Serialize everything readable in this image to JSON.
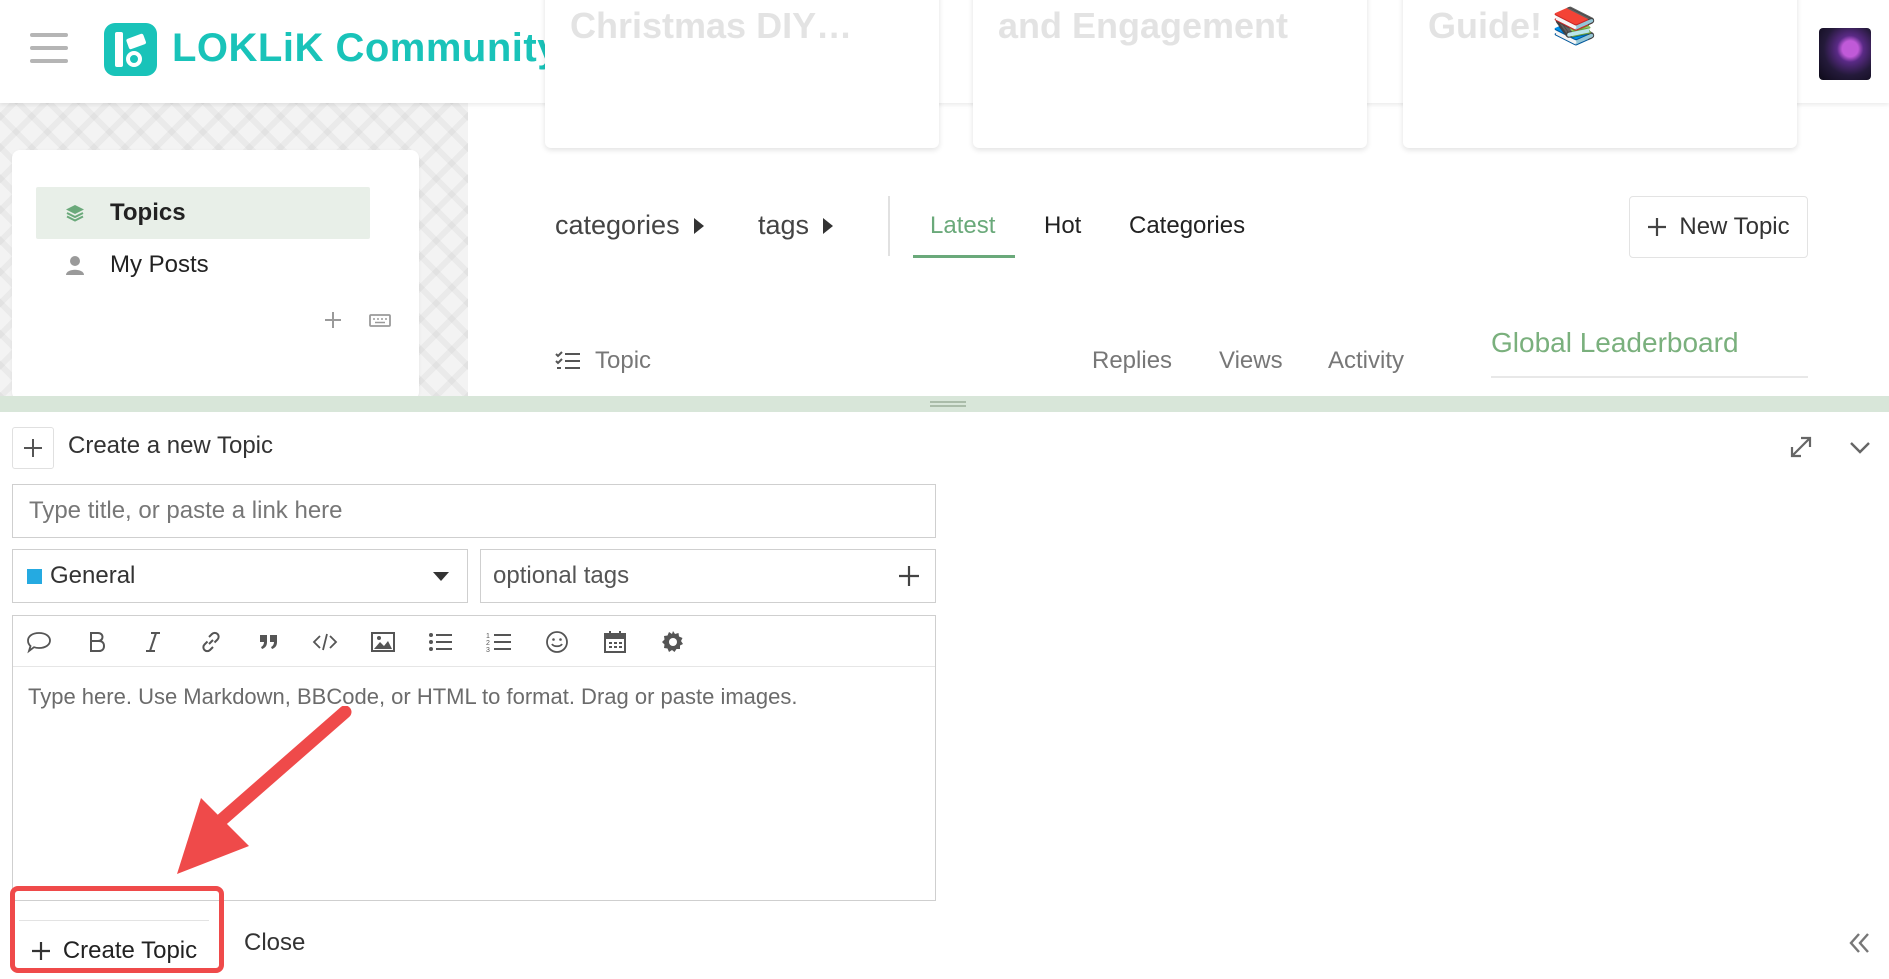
{
  "header": {
    "brand": "LOKLiK Community",
    "featured": [
      {
        "title": "Christmas DIY…"
      },
      {
        "title": "and Engagement"
      },
      {
        "title": "Guide! 📚"
      }
    ]
  },
  "sidebar": {
    "items": [
      {
        "label": "Topics",
        "active": true,
        "icon": "layers-icon"
      },
      {
        "label": "My Posts",
        "active": false,
        "icon": "user-icon"
      }
    ]
  },
  "nav": {
    "categories_label": "categories",
    "tags_label": "tags",
    "tabs": [
      {
        "label": "Latest",
        "active": true
      },
      {
        "label": "Hot",
        "active": false
      },
      {
        "label": "Categories",
        "active": false
      }
    ],
    "new_topic_label": "New Topic"
  },
  "topic_list": {
    "headers": {
      "topic": "Topic",
      "replies": "Replies",
      "views": "Views",
      "activity": "Activity"
    },
    "leaderboard": "Global Leaderboard"
  },
  "composer": {
    "title": "Create a new Topic",
    "title_placeholder": "Type title, or paste a link here",
    "category": "General",
    "category_color": "#25aae1",
    "tags_placeholder": "optional tags",
    "editor_placeholder": "Type here. Use Markdown, BBCode, or HTML to format. Drag or paste images.",
    "create_label": "Create Topic",
    "close_label": "Close"
  },
  "colors": {
    "brand": "#19c3b9",
    "accent_green": "#6aa97a",
    "leaderboard_green": "#7ab07d",
    "highlight_red": "#ef4a4a",
    "resize_bar": "#d8e6d9"
  }
}
